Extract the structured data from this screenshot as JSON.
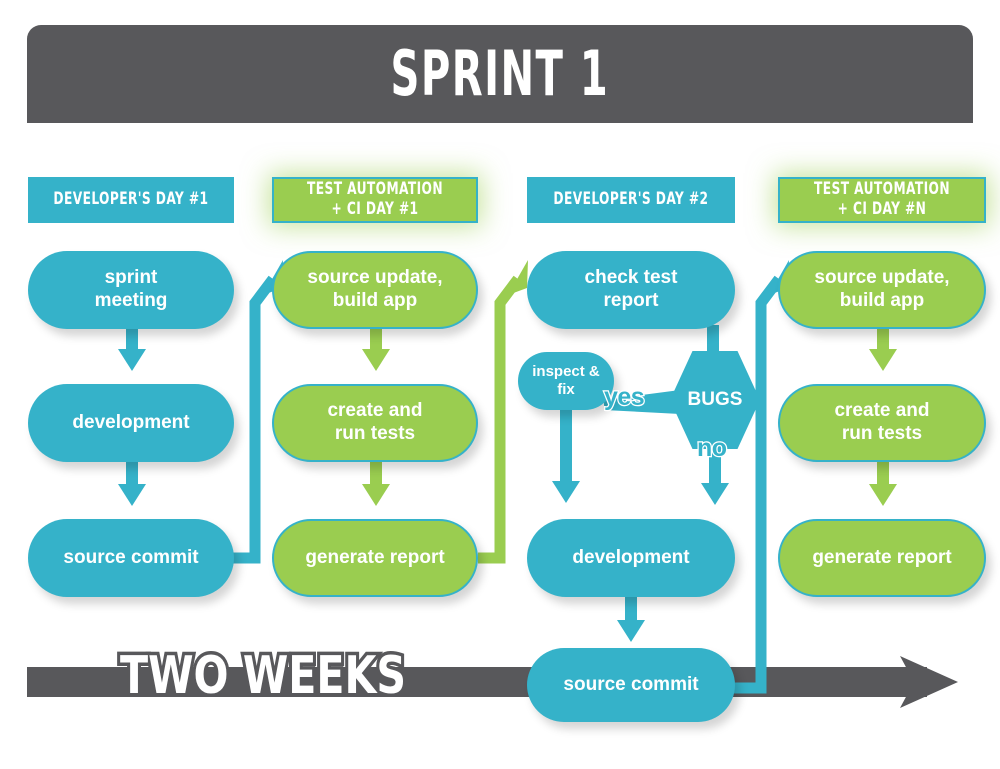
{
  "banner": {
    "title": "SPRINT 1",
    "background_color": "#58585b"
  },
  "colors": {
    "blue": "#35b2c9",
    "green": "#9acd50",
    "dark_gray": "#58585b",
    "white": "#ffffff"
  },
  "columns": [
    {
      "header": "DEVELOPER'S DAY #1",
      "header_style": "blue",
      "nodes": [
        {
          "label": "sprint\nmeeting",
          "style": "blue"
        },
        {
          "label": "development",
          "style": "blue"
        },
        {
          "label": "source commit",
          "style": "blue"
        }
      ]
    },
    {
      "header": "TEST AUTOMATION\n+ CI DAY #1",
      "header_style": "green",
      "nodes": [
        {
          "label": "source update,\nbuild app",
          "style": "green"
        },
        {
          "label": "create and\nrun tests",
          "style": "green"
        },
        {
          "label": "generate report",
          "style": "green"
        }
      ]
    },
    {
      "header": "DEVELOPER'S DAY #2",
      "header_style": "blue",
      "nodes": [
        {
          "label": "check test\nreport",
          "style": "blue"
        },
        {
          "label": "inspect &\nfix",
          "style": "blue"
        },
        {
          "label": "BUGS",
          "style": "hexagon"
        },
        {
          "label": "development",
          "style": "blue"
        },
        {
          "label": "source commit",
          "style": "blue"
        }
      ]
    },
    {
      "header": "TEST AUTOMATION\n+ CI DAY #N",
      "header_style": "green",
      "nodes": [
        {
          "label": "source update,\nbuild app",
          "style": "green"
        },
        {
          "label": "create and\nrun tests",
          "style": "green"
        },
        {
          "label": "generate report",
          "style": "green"
        }
      ]
    }
  ],
  "edge_labels": {
    "yes": "yes",
    "no": "no"
  },
  "timeline": {
    "label": "TWO WEEKS",
    "color": "#58585b"
  }
}
